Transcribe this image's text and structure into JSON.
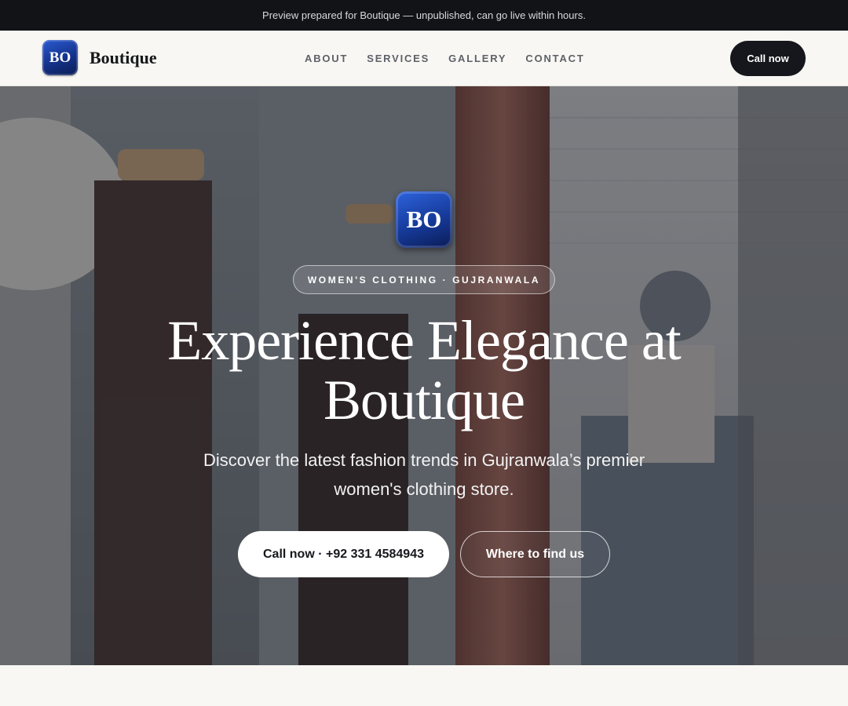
{
  "preview_bar": {
    "text": "Preview prepared for Boutique — unpublished, can go live within hours."
  },
  "nav": {
    "logo_text": "BO",
    "brand_name": "Boutique",
    "links": [
      "ABOUT",
      "SERVICES",
      "GALLERY",
      "CONTACT"
    ],
    "cta": "Call now"
  },
  "hero": {
    "logo_text": "BO",
    "eyebrow": "WOMEN'S CLOTHING · GUJRANWALA",
    "title": "Experience Elegance at Boutique",
    "subtitle": "Discover the latest fashion trends in Gujranwala’s premier women's clothing store.",
    "primary_button": "Call now · +92 331 4584943",
    "secondary_button": "Where to find us"
  },
  "colors": {
    "top_bar": "#111317",
    "nav_background": "#f8f7f3",
    "logo_blue": "#163a99",
    "cta_dark": "#15171c",
    "hero_text": "#ffffff"
  },
  "icons": {
    "logo": "bo-monogram-badge"
  }
}
